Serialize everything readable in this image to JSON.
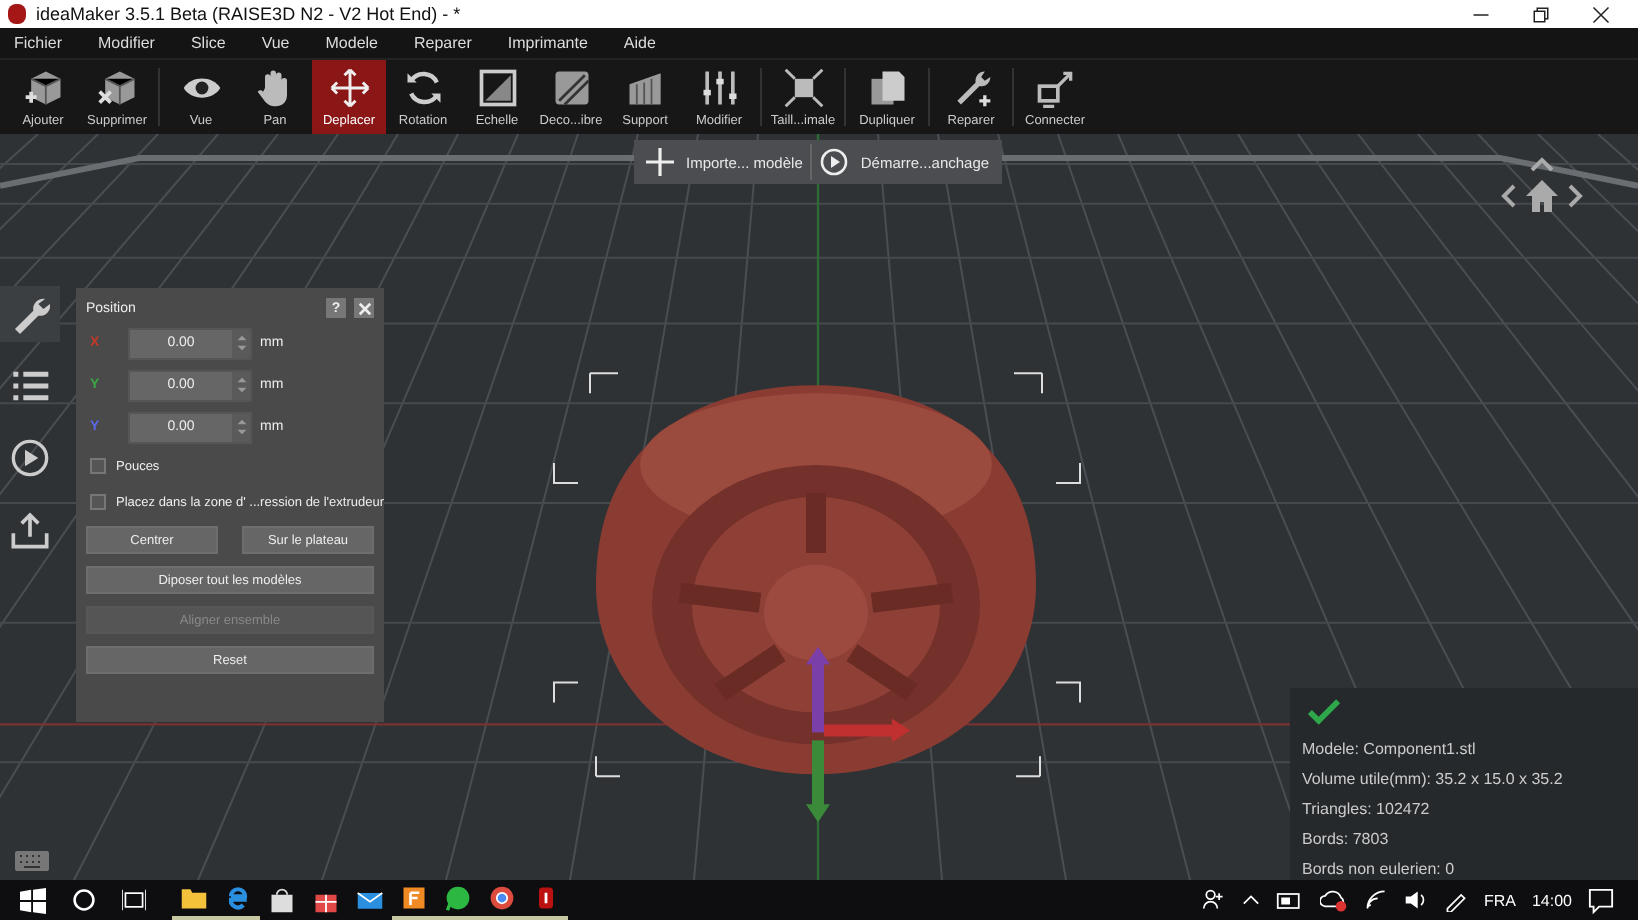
{
  "window": {
    "title": "ideaMaker 3.5.1 Beta (RAISE3D N2 - V2 Hot End) - *"
  },
  "menu": [
    "Fichier",
    "Modifier",
    "Slice",
    "Vue",
    "Modele",
    "Reparer",
    "Imprimante",
    "Aide"
  ],
  "toolbar_groups": [
    [
      {
        "label": "Ajouter",
        "selected": false
      },
      {
        "label": "Supprimer",
        "selected": false
      }
    ],
    [
      {
        "label": "Vue",
        "selected": false
      },
      {
        "label": "Pan",
        "selected": false
      },
      {
        "label": "Deplacer",
        "selected": true
      },
      {
        "label": "Rotation",
        "selected": false
      },
      {
        "label": "Echelle",
        "selected": false
      },
      {
        "label": "Deco...ibre",
        "selected": false
      },
      {
        "label": "Support",
        "selected": false
      },
      {
        "label": "Modifier",
        "selected": false
      }
    ],
    [
      {
        "label": "Taill...imale",
        "selected": false
      }
    ],
    [
      {
        "label": "Dupliquer",
        "selected": false
      }
    ],
    [
      {
        "label": "Reparer",
        "selected": false
      }
    ],
    [
      {
        "label": "Connecter",
        "selected": false
      }
    ]
  ],
  "top_buttons": [
    {
      "label": "Importe... modèle"
    },
    {
      "label": "Démarre...anchage"
    }
  ],
  "side_tabs": [
    {
      "selected": true
    },
    {
      "selected": false
    },
    {
      "selected": false
    },
    {
      "selected": false
    }
  ],
  "position_panel": {
    "title": "Position",
    "help": "?",
    "fields": [
      {
        "axis": "X",
        "value": "0.00",
        "unit": "mm",
        "color": "#c0392b"
      },
      {
        "axis": "Y",
        "value": "0.00",
        "unit": "mm",
        "color": "#3aa845"
      },
      {
        "axis": "Y",
        "value": "0.00",
        "unit": "mm",
        "color": "#5a68e8"
      }
    ],
    "checkboxes": [
      {
        "label": "Pouces",
        "checked": false
      },
      {
        "label": "Placez dans la zone d' ...ression de l'extrudeur",
        "checked": false
      }
    ],
    "button_rows": [
      [
        {
          "label": "Centrer",
          "disabled": false
        },
        {
          "label": "Sur le plateau",
          "disabled": false
        }
      ],
      [
        {
          "label": "Diposer tout les modèles",
          "disabled": false
        }
      ],
      [
        {
          "label": "Aligner ensemble",
          "disabled": true
        }
      ],
      [
        {
          "label": "Reset",
          "disabled": false
        }
      ]
    ]
  },
  "model_info": {
    "lines": [
      "Modele: Component1.stl",
      "Volume utile(mm): 35.2 x 15.0 x 35.2",
      "Triangles: 102472",
      "Bords: 7803",
      "Bords non eulerien: 0"
    ]
  },
  "taskbar": {
    "apps": [
      {
        "running": true
      },
      {
        "running": true
      },
      {
        "running": false
      },
      {
        "running": false
      },
      {
        "running": false
      },
      {
        "running": true
      },
      {
        "running": true
      },
      {
        "running": true
      },
      {
        "running": true
      }
    ],
    "language": "FRA",
    "time": "14:00"
  }
}
